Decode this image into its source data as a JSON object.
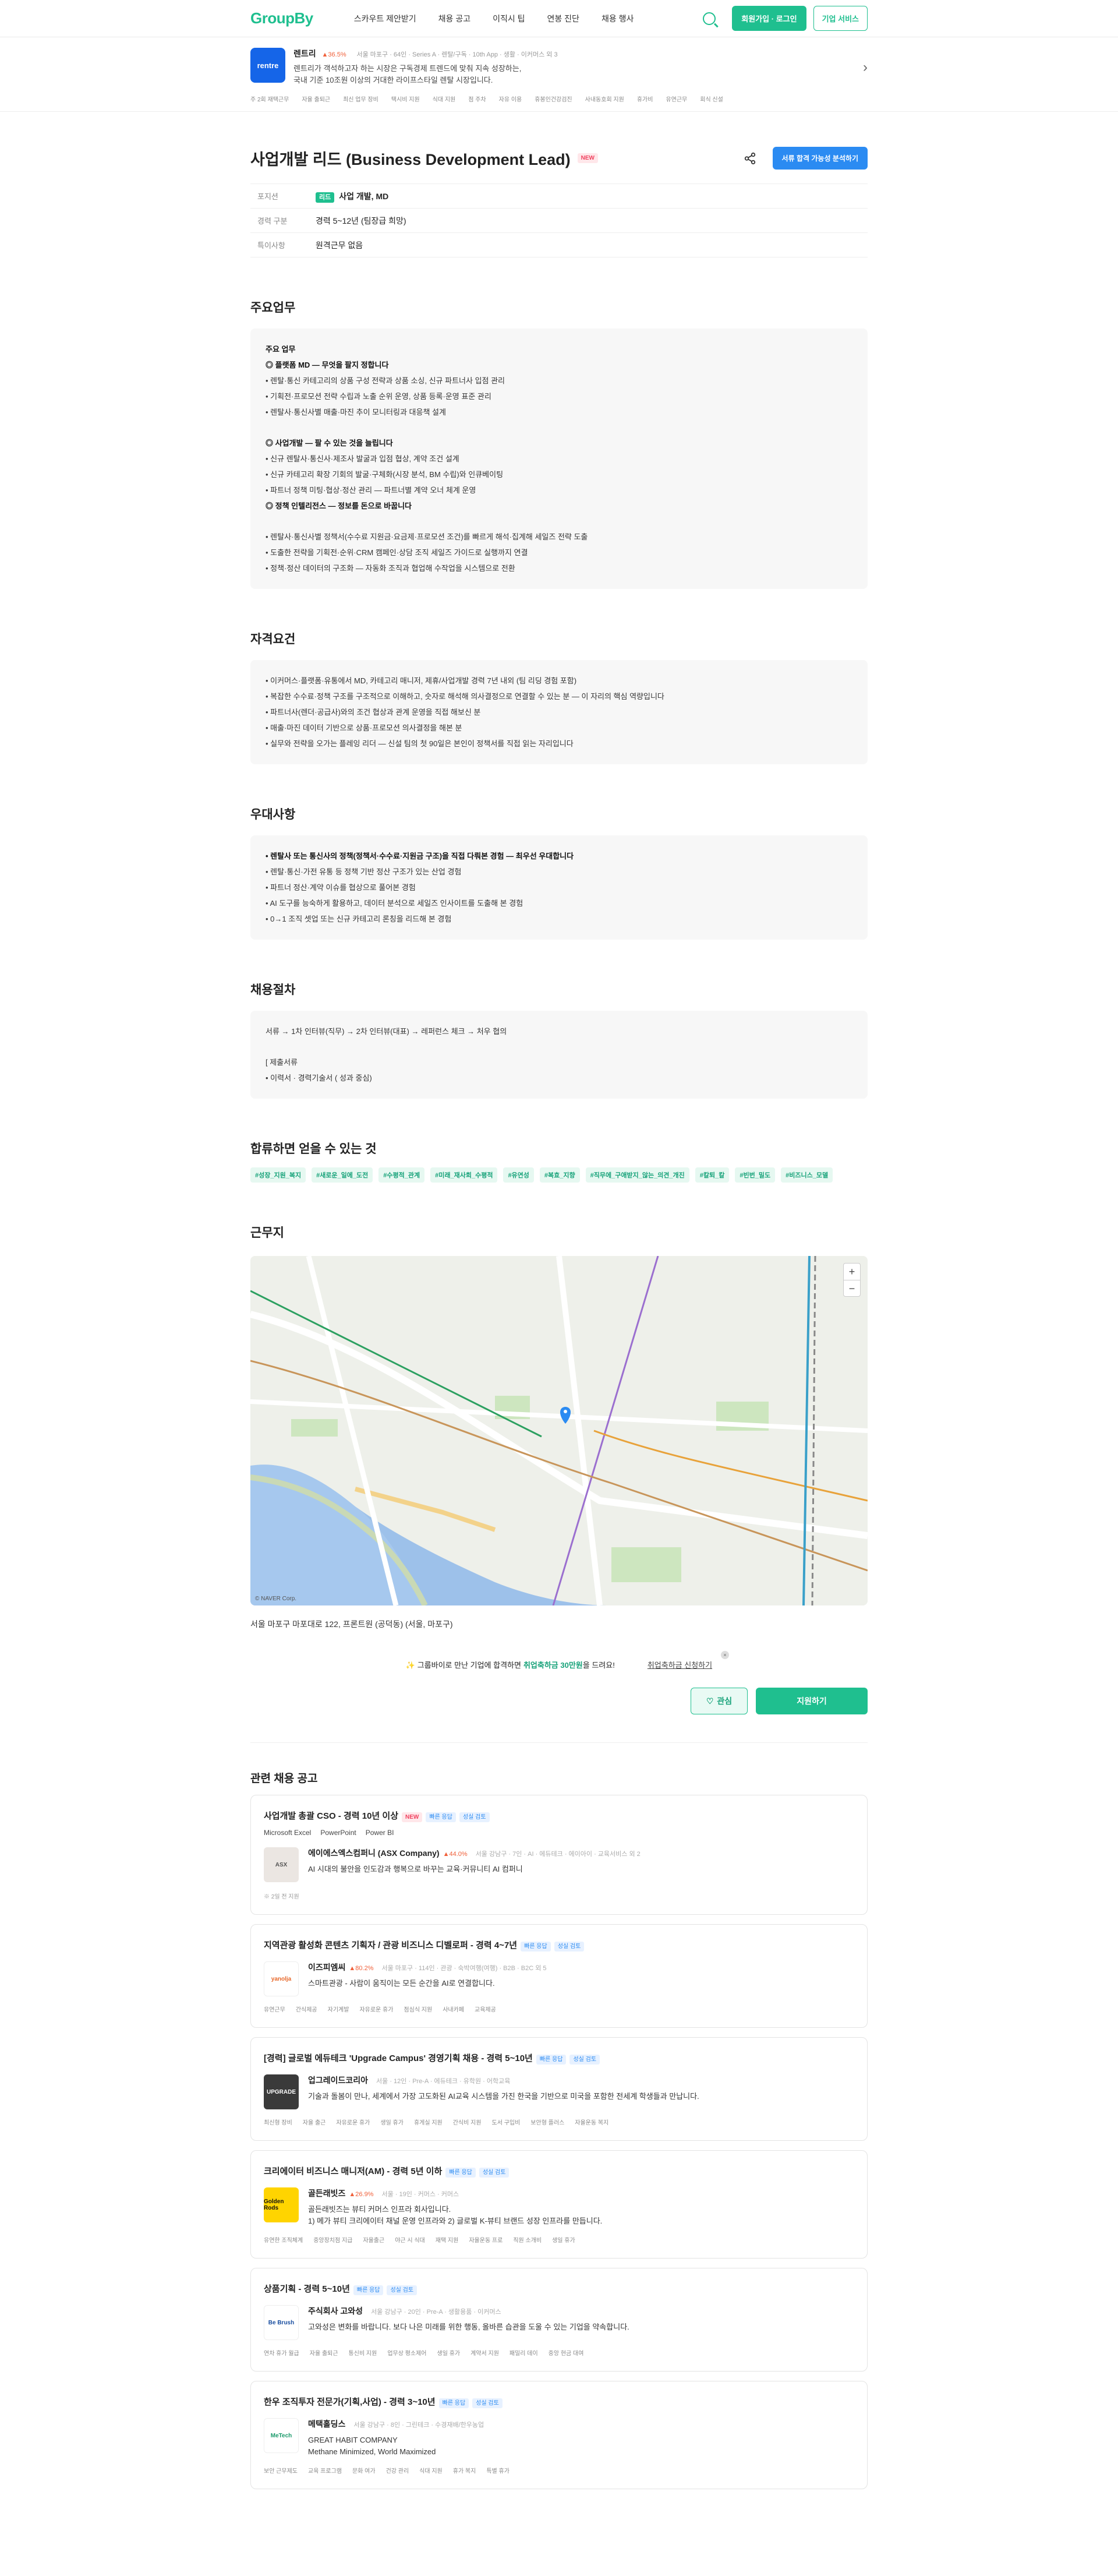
{
  "nav": {
    "logo": "GroupBy",
    "links": [
      "스카우트 제안받기",
      "채용 공고",
      "이직시 팁",
      "연봉 진단",
      "채용 행사"
    ],
    "login": "회원가입 · 로그인",
    "enterprise": "기업 서비스"
  },
  "company": {
    "logo_text": "rentre",
    "name": "렌트리",
    "rate": "▲36.5%",
    "meta": "서울 마포구 · 64인 · Series A · 렌탈/구독 · 10th App · 생활 · 이커머스 외 3",
    "desc1": "렌트리가 객석하고자 하는 시장은 구독경제 트렌드에 맞춰 지속 성장하는,",
    "desc2": "국내 기준 10조원 이상의 거대한 라이프스타일 렌탈 시장입니다.",
    "tags": [
      "주 2회 재택근무",
      "자율 출퇴근",
      "최신 업무 장비",
      "택시비 지원",
      "식대 지원",
      "점 주차",
      "자유 이용",
      "휴봉인건강검진",
      "사내동호회 지원",
      "휴가비",
      "유연근무",
      "회식 신설"
    ]
  },
  "job": {
    "title": "사업개발 리드 (Business Development Lead)",
    "new": "NEW",
    "share_icon": "share-icon",
    "apply_btn": "서류 합격 가능성 분석하기"
  },
  "info": [
    {
      "label": "포지션",
      "tag": "리드",
      "value": "사업 개발, MD"
    },
    {
      "label": "경력 구분",
      "value": "경력 5~12년 (팀장급 희망)"
    },
    {
      "label": "특이사항",
      "value": "원격근무 없음"
    }
  ],
  "sections": {
    "duties": "주요업무",
    "quals": "자격요건",
    "prefer": "우대사항",
    "process": "채용절차",
    "benefits": "합류하면 얻을 수 있는 것",
    "location": "근무지"
  },
  "duties": {
    "heading": "주요 업무",
    "g1": "◎ 플랫폼 MD — 무엇을 팔지 정합니다",
    "g1_items": [
      "• 렌탈·통신 카테고리의 상품 구성 전략과 상품 소싱, 신규 파트너사 입점 관리",
      "• 기획전·프로모션 전략 수립과 노출 순위 운영, 상품 등록·운영 표준 관리",
      "• 렌탈사·통신사별 매출·마진 추이 모니터링과 대응책 설계"
    ],
    "g2": "◎ 사업개발 — 팔 수 있는 것을 늘립니다",
    "g2_items": [
      "• 신규 렌탈사·통신사·제조사 발굴과 입점 협상, 계약 조건 설계",
      "• 신규 카테고리 확장 기회의 발굴·구체화(시장 분석, BM 수립)와 인큐베이팅",
      "• 파트너 정책 미팅·협상·정산 관리 — 파트너별 계약 오너 체계 운영"
    ],
    "g3": "◎ 정책 인텔리전스 — 정보를 돈으로 바꿉니다",
    "g3_items": [
      "• 렌탈사·통신사별 정책서(수수료 지원금·요금제·프로모션 조건)를 빠르게 해석·집계해 세일즈 전략 도출",
      "• 도출한 전략을 기획전·순위·CRM 캠페인·상담 조직 세일즈 가이드로 실행까지 연결",
      "• 정책·정산 데이터의 구조화 — 자동화 조직과 협업해 수작업을 시스템으로 전환"
    ]
  },
  "quals": [
    "• 이커머스·플랫폼·유통에서 MD, 카테고리 매니저, 제휴/사업개발 경력 7년 내외 (팀 리딩 경험 포함)",
    "• 복잡한 수수료·정책 구조를 구조적으로 이해하고, 숫자로 해석해 의사결정으로 연결할 수 있는 분 — 이 자리의 핵심 역량입니다",
    "• 파트너사(렌더·공급사)와의 조건 협상과 관계 운영을 직접 해보신 분",
    "• 매출·마진 데이터 기반으로 상품·프로모션 의사결정을 해본 분",
    "• 실무와 전략을 오가는 플레잉 리더 — 신설 팀의 첫 90일은 본인이 정책서를 직접 읽는 자리입니다"
  ],
  "prefer": {
    "bold": "• 렌탈사 또는 통신사의 정책(정책서·수수료·지원금 구조)을 직접 다뤄본 경험 — 최우선 우대합니다",
    "items": [
      "• 렌탈·통신·가전 유통 등 정책 기반 정산 구조가 있는 산업 경험",
      "• 파트너 정산·계약 이슈를 협상으로 풀어본 경험",
      "• AI 도구를 능숙하게 활용하고, 데이터 분석으로 세일즈 인사이트를 도출해 본 경험",
      "• 0→1 조직 셋업 또는 신규 카테고리 론칭을 리드해 본 경험"
    ]
  },
  "process": {
    "flow": "서류 → 1차 인터뷰(직무) → 2차 인터뷰(대표) → 레퍼런스 체크 → 처우 협의",
    "sub": "[ 제출서류",
    "doc": "• 이력서 · 경력기술서 ( 성과 중심)"
  },
  "hashtags": [
    "#성장_지원_복지",
    "#새로운_일에_도전",
    "#수평적_관계",
    "#미래_재사회_수평적",
    "#유연성",
    "#복효_지향",
    "#직무에_구애받지_않는_의견_개진",
    "#칼퇴_칼",
    "#빈번_밀도",
    "#비즈니스_모델"
  ],
  "map": {
    "copyright": "© NAVER Corp.",
    "zoom_in": "+",
    "zoom_out": "−",
    "address": "서울 마포구 마포대로 122, 프론트원 (공덕동) (서울, 마포구)"
  },
  "promo": {
    "pre": "✨ 그룹바이로 만난 기업에 합격하면",
    "highlight": "취업축하금 30만원",
    "post": "을 드려요!",
    "link": "취업축하금 신청하기",
    "close": "×"
  },
  "actions": {
    "like": "관심",
    "apply": "지원하기"
  },
  "related": {
    "title": "관련 채용 공고",
    "cards": [
      {
        "title": "사업개발 총괄 CSO - 경력 10년 이상",
        "new": "NEW",
        "pills": [
          "빠른 응답",
          "성실 검토"
        ],
        "skills": [
          "Microsoft Excel",
          "PowerPoint",
          "Power BI"
        ],
        "logo": "ASX",
        "logo_bg": "#ebe6e2",
        "logo_fg": "#555",
        "co": "에이에스엑스컴퍼니 (ASX Company)",
        "rate": "▲44.0%",
        "meta": "서울 강남구 · 7인 · AI · 에듀테크 · 에이아이 · 교육서비스 외 2",
        "desc": "AI 시대의 불안을 인도감과 행복으로 바꾸는 교육·커뮤니티 AI 컴퍼니",
        "tags": [],
        "note": "※ 2일 전 지원"
      },
      {
        "title": "지역관광 활성화 콘텐츠 기획자 / 관광 비즈니스 디벨로퍼 - 경력 4~7년",
        "new": "",
        "pills": [
          "빠른 응답",
          "성실 검토"
        ],
        "skills": [],
        "logo": "yanolja",
        "logo_bg": "#fff",
        "logo_fg": "#e8682a",
        "co": "이즈피엠씨",
        "rate": "▲80.2%",
        "meta": "서울 마포구 · 114인 · 관광 · 숙박여행(여행) · B2B · B2C 외 5",
        "desc": "스마트관광 - 사람이 움직이는 모든 순간을 AI로 연결합니다.",
        "tags": [
          "유연근무",
          "간식제공",
          "자기계발",
          "자유로운 휴가",
          "점심식 지원",
          "사내카페",
          "교육제공"
        ],
        "note": ""
      },
      {
        "title": "[경력] 글로벌 에듀테크 'Upgrade Campus' 경영기획 채용 - 경력 5~10년",
        "new": "",
        "pills": [
          "빠른 응답",
          "성실 검토"
        ],
        "skills": [],
        "logo": "UPGRADE",
        "logo_bg": "#3a3a3a",
        "logo_fg": "#fff",
        "co": "업그레이드코리아",
        "rate": "",
        "meta": "서울 · 12인 · Pre-A · 에듀테크 · 유학원 · 어학교육",
        "desc": "기술과 돌봄이 만나, 세계에서 가장 고도화된 AI교육 시스템을 가진 한국을 기반으로 미국을 포함한 전세계 학생들과 만납니다.",
        "tags": [
          "최신형 장비",
          "자율 출근",
          "자유로운 휴가",
          "생일 휴가",
          "휴게실 지원",
          "간식비 지원",
          "도서 구입비",
          "보안형 플러스",
          "자율운동 복지"
        ],
        "note": ""
      },
      {
        "title": "크리에이터 비즈니스 매니저(AM) - 경력 5년 이하",
        "new": "",
        "pills": [
          "빠른 응답",
          "성실 검토"
        ],
        "skills": [],
        "logo": "Golden Rods",
        "logo_bg": "#ffd400",
        "logo_fg": "#111",
        "co": "골든래빗즈",
        "rate": "▲26.9%",
        "meta": "서울 · 19인 · 커머스 · 커머스",
        "desc1": "골든래빗즈는 뷰티 커머스 인프라 회사입니다.",
        "desc": "1) 메가 뷰티 크리에이터 채널 운영 인프라와 2) 글로벌 K-뷰티 브랜드 성장 인프라를 만듭니다.",
        "tags": [
          "유연한 조직체계",
          "중앙장치점 지급",
          "자율출근",
          "야근 시 식대",
          "재택 지원",
          "자율운동 프로",
          "직원 소개비",
          "생일 휴가"
        ],
        "note": ""
      },
      {
        "title": "상품기획 - 경력 5~10년",
        "new": "",
        "pills": [
          "빠른 응답",
          "성실 검토"
        ],
        "skills": [],
        "logo": "Be Brush",
        "logo_bg": "#fff",
        "logo_fg": "#1b4fa0",
        "co": "주식회사 고와성",
        "rate": "",
        "meta": "서울 강남구 · 20인 · Pre-A · 생활용품 · 이커머스",
        "desc1": "고와성은 변화를 바랍니다. 보다 나은 미래를 위한 행동, 올바른 습관을 도울 수 있는 기업을 약속합니다.",
        "desc": "",
        "tags": [
          "연차 휴가 월급",
          "자율 출퇴근",
          "통신비 지원",
          "업무상 평소제어",
          "생일 휴가",
          "계약서 지원",
          "패밀리 데이",
          "중앙 현금 대여"
        ],
        "note": ""
      },
      {
        "title": "한우 조직투자 전문가(기획,사업) - 경력 3~10년",
        "new": "",
        "pills": [
          "빠른 응답",
          "성실 검토"
        ],
        "skills": [],
        "logo": "MeTech",
        "logo_bg": "#fff",
        "logo_fg": "#1a9a6a",
        "co": "메택홀딩스",
        "rate": "",
        "meta": "서울 강남구 · 8인 · 그린테크 · 수경재배/한우농업",
        "desc1": "GREAT HABIT COMPANY",
        "desc": "Methane Minimized, World Maximized",
        "tags": [
          "보안 근무제도",
          "교육 프로그램",
          "문화 여가",
          "건강 관리",
          "식대 지원",
          "휴가 복지",
          "특별 휴가"
        ],
        "note": ""
      }
    ]
  }
}
